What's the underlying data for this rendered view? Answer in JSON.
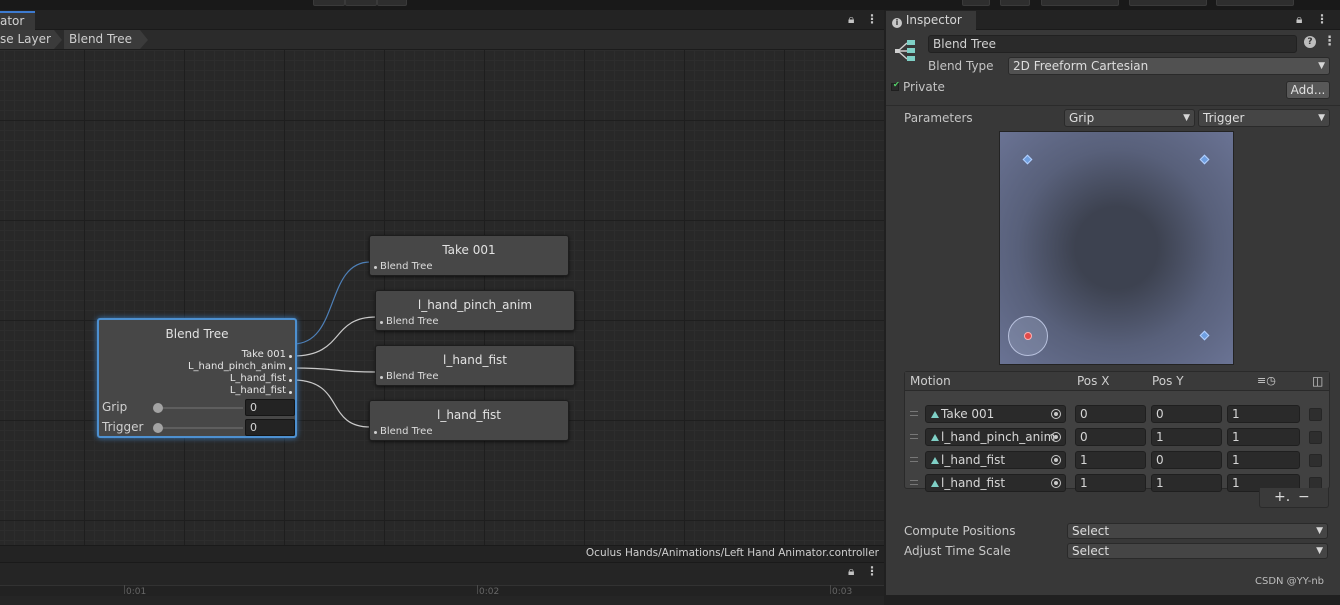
{
  "colors": {
    "accent": "#3d7bd0",
    "selected_node_border": "#4d90d0",
    "bg_dark": "#202020",
    "blend_point": "#6f9fe0",
    "current_point": "#e24a4a"
  },
  "animator": {
    "tab_label": "ator",
    "breadcrumb": [
      "se Layer",
      "Blend Tree"
    ],
    "status_path": "Oculus Hands/Animations/Left Hand Animator.controller",
    "timeline_ticks": [
      "0:01",
      "0:02",
      "0:03"
    ],
    "lock_icon": "lock-icon",
    "menu_icon": "kebab-menu-icon"
  },
  "graph": {
    "blend_node": {
      "title": "Blend Tree",
      "outputs": [
        "Take 001",
        "L_hand_pinch_anim",
        "L_hand_fist",
        "L_hand_fist"
      ],
      "params": [
        {
          "name": "Grip",
          "value": "0",
          "level": 0
        },
        {
          "name": "Trigger",
          "value": "0",
          "level": 0
        }
      ]
    },
    "child_nodes": [
      {
        "title": "Take 001",
        "port": "Blend Tree"
      },
      {
        "title": "l_hand_pinch_anim",
        "port": "Blend Tree"
      },
      {
        "title": "l_hand_fist",
        "port": "Blend Tree"
      },
      {
        "title": "l_hand_fist",
        "port": "Blend Tree"
      }
    ]
  },
  "inspector": {
    "tab_label": "Inspector",
    "name_value": "Blend Tree",
    "blend_type_label": "Blend Type",
    "blend_type_value": "2D Freeform Cartesian",
    "private_label": "Private",
    "private_checked": true,
    "add_button": "Add...",
    "parameters_label": "Parameters",
    "param_x": "Grip",
    "param_y": "Trigger",
    "blend_points": [
      {
        "x": 0,
        "y": 1
      },
      {
        "x": 1,
        "y": 1
      },
      {
        "x": 1,
        "y": 0
      }
    ],
    "current_point": {
      "x": 0,
      "y": 0
    },
    "motion_headers": {
      "motion": "Motion",
      "posx": "Pos X",
      "posy": "Pos Y"
    },
    "motions": [
      {
        "name": "Take 001",
        "posx": "0",
        "posy": "0",
        "speed": "1"
      },
      {
        "name": "l_hand_pinch_anim",
        "posx": "0",
        "posy": "1",
        "speed": "1"
      },
      {
        "name": "l_hand_fist",
        "posx": "1",
        "posy": "0",
        "speed": "1"
      },
      {
        "name": "l_hand_fist",
        "posx": "1",
        "posy": "1",
        "speed": "1"
      }
    ],
    "plus": "+.",
    "minus": "−",
    "compute_positions_label": "Compute Positions",
    "compute_positions_value": "Select",
    "adjust_time_label": "Adjust Time Scale",
    "adjust_time_value": "Select",
    "watermark": "CSDN @YY-nb"
  }
}
